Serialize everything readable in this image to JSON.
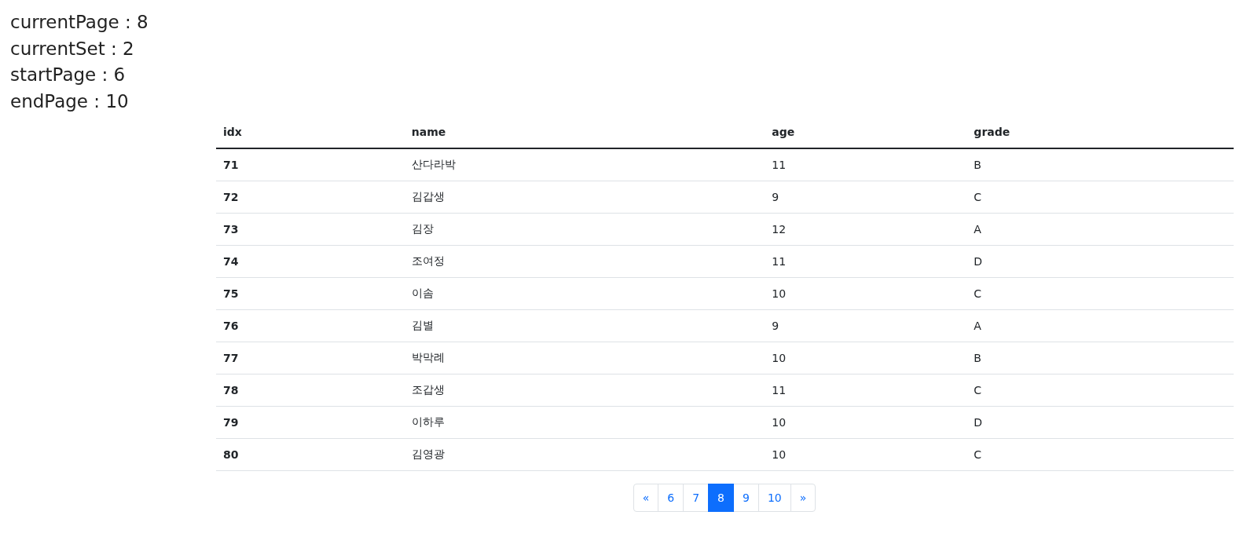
{
  "info_lines": [
    "currentPage : 8",
    "currentSet : 2",
    "startPage : 6",
    "endPage : 10"
  ],
  "table": {
    "columns": [
      "idx",
      "name",
      "age",
      "grade"
    ],
    "rows": [
      [
        "71",
        "산다라박",
        "11",
        "B"
      ],
      [
        "72",
        "김갑생",
        "9",
        "C"
      ],
      [
        "73",
        "김장",
        "12",
        "A"
      ],
      [
        "74",
        "조여정",
        "11",
        "D"
      ],
      [
        "75",
        "이솜",
        "10",
        "C"
      ],
      [
        "76",
        "김별",
        "9",
        "A"
      ],
      [
        "77",
        "박막례",
        "10",
        "B"
      ],
      [
        "78",
        "조갑생",
        "11",
        "C"
      ],
      [
        "79",
        "이하루",
        "10",
        "D"
      ],
      [
        "80",
        "김영광",
        "10",
        "C"
      ]
    ]
  },
  "pagination": [
    {
      "label": "«",
      "selected": false
    },
    {
      "label": "6",
      "selected": false
    },
    {
      "label": "7",
      "selected": false
    },
    {
      "label": "8",
      "selected": true
    },
    {
      "label": "9",
      "selected": false
    },
    {
      "label": "10",
      "selected": false
    },
    {
      "label": "»",
      "selected": false
    }
  ]
}
